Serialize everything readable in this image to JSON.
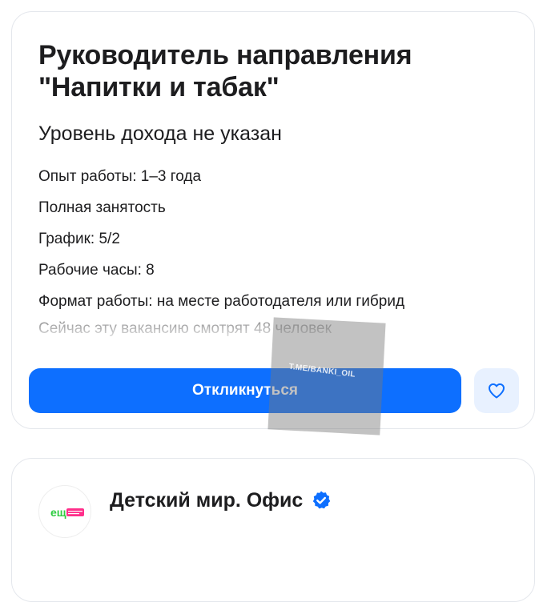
{
  "vacancy": {
    "title": "Руководитель направления \"Напитки и табак\"",
    "salary": "Уровень дохода не указан",
    "details": [
      "Опыт работы: 1–3 года",
      "Полная занятость",
      "График: 5/2",
      "Рабочие часы: 8",
      "Формат работы: на месте работодателя или гибрид"
    ],
    "viewers": "Сейчас эту вакансию смотрят 48 человек",
    "respond_label": "Откликнуться",
    "favorite_icon": "heart-icon"
  },
  "watermark": {
    "text": "T.ME/BANKI_OIL"
  },
  "company": {
    "name": "Детский мир. Офис",
    "verified_icon": "verified-check-icon",
    "logo_text": "ещё"
  },
  "colors": {
    "accent": "#0d6fff",
    "accent_light": "#e8f1ff",
    "logo_green": "#2ecc40",
    "logo_pink": "#ff2e8a"
  }
}
